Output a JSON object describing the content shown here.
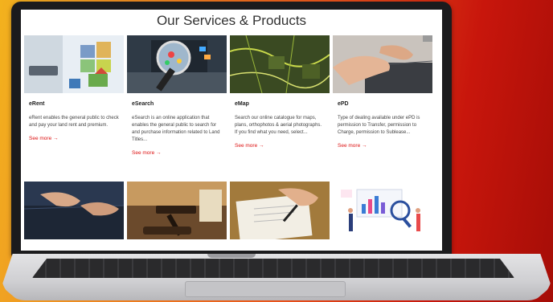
{
  "section": {
    "title": "Our Services & Products"
  },
  "cards": [
    {
      "name": "eRent",
      "description": "eRent enables the general public to check and pay your land rent and premium.",
      "link": "See more →"
    },
    {
      "name": "eSearch",
      "description": "eSearch is an online application that enables the general public to search for and purchase information related to Land Titles...",
      "link": "See more →"
    },
    {
      "name": "eMap",
      "description": "Search our online catalogue for maps, plans, orthophotos & aerial photographs. If you find what you need, select...",
      "link": "See more →"
    },
    {
      "name": "ePD",
      "description": "Type of dealing available under ePD is permission to Transfer, permission to Charge, permission to Sublease...",
      "link": "See more →"
    }
  ],
  "icons": {
    "card1": "house-blocks-image",
    "card2": "magnifier-laptop-image",
    "card3": "aerial-map-image",
    "card4": "typing-hands-image",
    "card5": "laptop-typing-image",
    "card6": "gavel-image",
    "card7": "signing-document-image",
    "card8": "data-analysis-illustration"
  },
  "colors": {
    "link": "#dd1111",
    "background_start": "#f3b21d",
    "background_end": "#a50d07"
  }
}
